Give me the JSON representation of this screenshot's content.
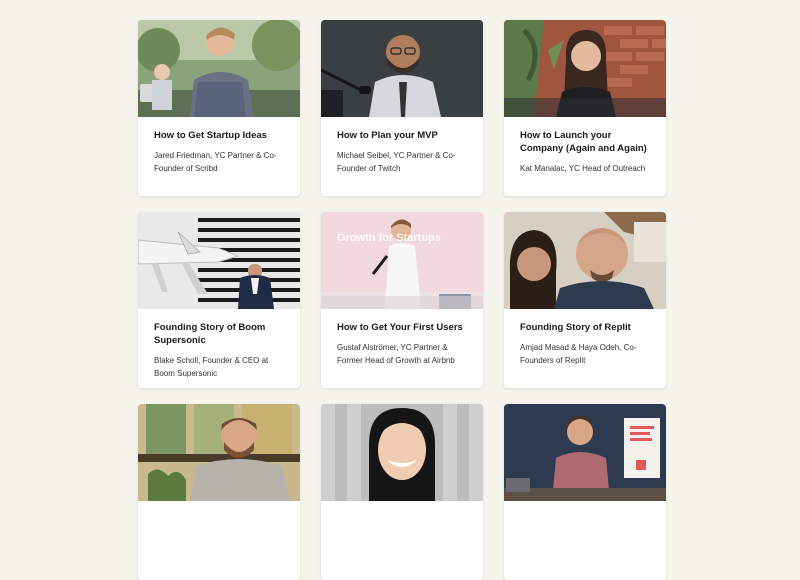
{
  "colors": {
    "page_background": "#f5f5ee",
    "card_background": "#ffffff",
    "title_text": "#1a1a1a",
    "subtitle_text": "#333333"
  },
  "cards": [
    {
      "title": "How to Get Startup Ideas",
      "subtitle": "Jared Friedman, YC Partner & Co-Founder of Scribd",
      "image": "photo-man-plaid-shirt-outdoors"
    },
    {
      "title": "How to Plan your MVP",
      "subtitle": "Michael Seibel, YC Partner & Co-Founder of Twitch",
      "image": "photo-man-glasses-microphone"
    },
    {
      "title": "How to Launch your Company (Again and Again)",
      "subtitle": "Kat Manalac, YC Head of Outreach",
      "image": "photo-woman-brick-wall"
    },
    {
      "title": "Founding Story of Boom Supersonic",
      "subtitle": "Blake Scholl, Founder & CEO at Boom Supersonic",
      "image": "photo-man-jet-aircraft"
    },
    {
      "title": "How to Get Your First Users",
      "subtitle": "Gustaf Alströmer, YC Partner & Former Head of Growth at Airbnb",
      "image": "photo-speaker-presenting-slide",
      "slide_text": "Growth for Startups"
    },
    {
      "title": "Founding Story of Replit",
      "subtitle": "Amjad Masad & Haya Odeh, Co-Founders of Replit",
      "image": "photo-couple-selfie"
    },
    {
      "title": "",
      "subtitle": "",
      "image": "photo-man-beard-window"
    },
    {
      "title": "",
      "subtitle": "",
      "image": "photo-woman-smiling-gray-wall"
    },
    {
      "title": "",
      "subtitle": "",
      "image": "photo-man-desk-poster"
    }
  ]
}
